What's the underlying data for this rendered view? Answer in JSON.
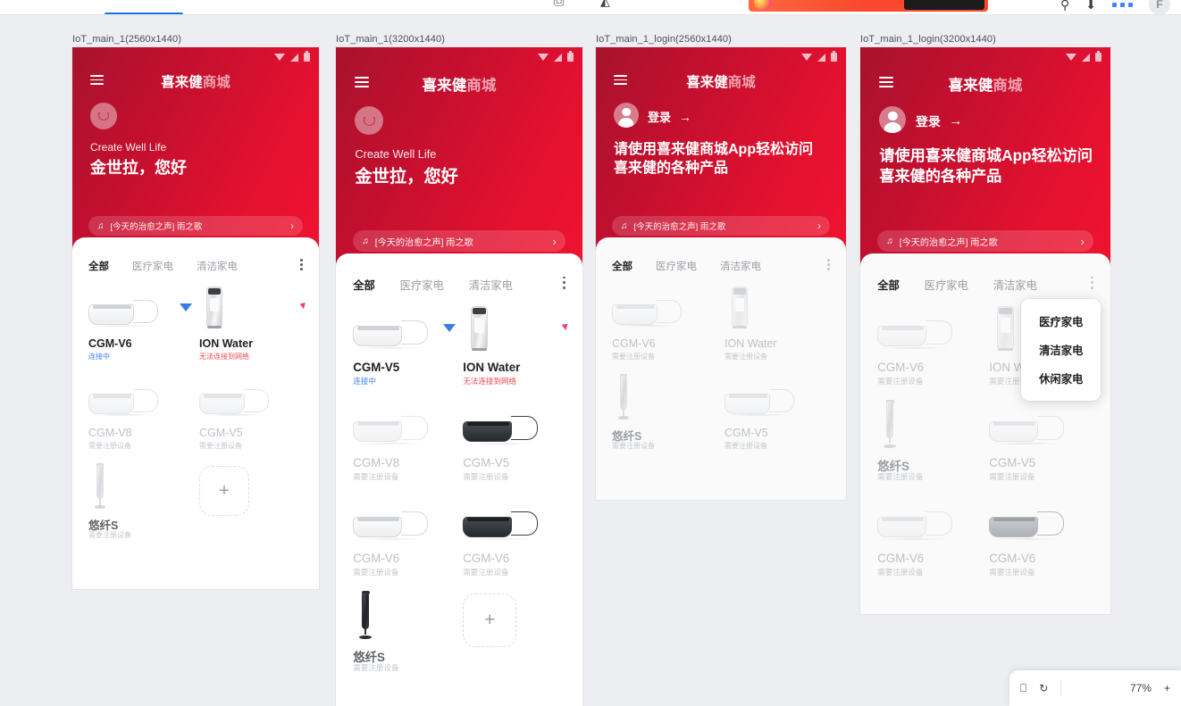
{
  "chrome": {
    "banner_cta_label": "",
    "avatar_initial": "F",
    "search_icon": "search-icon",
    "download_icon": "download-icon",
    "extensions_icon": "extensions-icon",
    "page_icon": "page-icon",
    "shield_icon": "shield-icon"
  },
  "zoom_toolbar": {
    "frame_icon": "frame-icon",
    "refresh_icon": "refresh-icon",
    "percent": "77%",
    "plus_label": "+"
  },
  "common": {
    "brand_strong": "喜来健",
    "brand_weak": "商城",
    "menu_icon": "hamburger-menu-icon",
    "music_note_icon": "music-note-icon",
    "music_text": "[今天的治愈之声] 雨之歌",
    "music_chevron": "›",
    "kebab_icon": "kebab-menu-icon",
    "add_tile_label": "+",
    "tabs": [
      "全部",
      "医疗家电",
      "清洁家电"
    ],
    "status_connecting": "连接中",
    "status_error": "无法连接到网络",
    "status_register": "需要注册设备",
    "login_label": "登录",
    "login_arrow": "→",
    "login_headline": "请使用喜来健商城App轻松访问\n喜来健的各种产品",
    "greet_small": "Create Well Life",
    "greet_big": "金世拉，您好",
    "wifi_badge_icon": "wifi-connecting-icon",
    "wifi_error_badge_icon": "wifi-error-icon"
  },
  "colors": {
    "brand_red": "#e3112f",
    "header_dark_red": "#a8132c",
    "connecting_blue": "#4285f4",
    "error_red": "#ea4c5a",
    "muted_grey": "#bdc1c6",
    "canvas_bg": "#eceef1"
  },
  "artboards": [
    {
      "label": "IoT_main_1(2560x1440)",
      "variant": "logged_in",
      "dim": false,
      "devices": [
        {
          "name": "CGM-V6",
          "status": "连接中",
          "status_type": "connecting",
          "art": "treadmill",
          "tone": "light",
          "badge": "blue"
        },
        {
          "name": "ION Water",
          "status": "无法连接到网络",
          "status_type": "error",
          "art": "purifier",
          "tone": "light",
          "badge": "red"
        },
        {
          "name": "CGM-V8",
          "status": "需要注册设备",
          "status_type": "register",
          "art": "treadmill",
          "tone": "grey",
          "badge": ""
        },
        {
          "name": "CGM-V5",
          "status": "需要注册设备",
          "status_type": "register",
          "art": "treadmill",
          "tone": "grey",
          "badge": ""
        },
        {
          "name": "悠纤S",
          "status": "需要注册设备",
          "status_type": "register",
          "art": "fan",
          "tone": "grey",
          "badge": ""
        }
      ],
      "has_add_tile": true,
      "menu_open": false
    },
    {
      "label": "IoT_main_1(3200x1440)",
      "variant": "logged_in",
      "dim": false,
      "devices": [
        {
          "name": "CGM-V5",
          "status": "连接中",
          "status_type": "connecting",
          "art": "treadmill",
          "tone": "light",
          "badge": "blue"
        },
        {
          "name": "ION Water",
          "status": "无法连接到网络",
          "status_type": "error",
          "art": "purifier",
          "tone": "light",
          "badge": "red"
        },
        {
          "name": "CGM-V8",
          "status": "需要注册设备",
          "status_type": "register",
          "art": "treadmill",
          "tone": "grey",
          "badge": ""
        },
        {
          "name": "CGM-V5",
          "status": "需要注册设备",
          "status_type": "register",
          "art": "treadmill",
          "tone": "dark",
          "badge": ""
        },
        {
          "name": "CGM-V6",
          "status": "需要注册设备",
          "status_type": "register",
          "art": "treadmill",
          "tone": "light",
          "badge": ""
        },
        {
          "name": "CGM-V6",
          "status": "需要注册设备",
          "status_type": "register",
          "art": "treadmill",
          "tone": "dark",
          "badge": ""
        },
        {
          "name": "悠纤S",
          "status": "需要注册设备",
          "status_type": "register",
          "art": "fan",
          "tone": "dark",
          "badge": ""
        }
      ],
      "has_add_tile": true,
      "menu_open": false
    },
    {
      "label": "IoT_main_1_login(2560x1440)",
      "variant": "logged_out",
      "dim": true,
      "devices": [
        {
          "name": "CGM-V6",
          "status": "需要注册设备",
          "status_type": "register",
          "art": "treadmill",
          "tone": "grey",
          "badge": ""
        },
        {
          "name": "ION Water",
          "status": "需要注册设备",
          "status_type": "register",
          "art": "purifier",
          "tone": "grey",
          "badge": ""
        },
        {
          "name": "悠纤S",
          "status": "需要注册设备",
          "status_type": "register",
          "art": "fan",
          "tone": "grey",
          "badge": ""
        },
        {
          "name": "CGM-V5",
          "status": "需要注册设备",
          "status_type": "register",
          "art": "treadmill",
          "tone": "grey",
          "badge": ""
        }
      ],
      "has_add_tile": false,
      "menu_open": false
    },
    {
      "label": "IoT_main_1_login(3200x1440)",
      "variant": "logged_out",
      "dim": true,
      "devices": [
        {
          "name": "CGM-V6",
          "status": "需要注册设备",
          "status_type": "register",
          "art": "treadmill",
          "tone": "grey",
          "badge": ""
        },
        {
          "name": "ION Water",
          "status": "需要注册设备",
          "status_type": "register",
          "art": "purifier",
          "tone": "grey",
          "badge": ""
        },
        {
          "name": "悠纤S",
          "status": "需要注册设备",
          "status_type": "register",
          "art": "fan",
          "tone": "grey",
          "badge": ""
        },
        {
          "name": "CGM-V5",
          "status": "需要注册设备",
          "status_type": "register",
          "art": "treadmill",
          "tone": "grey",
          "badge": ""
        },
        {
          "name": "CGM-V6",
          "status": "需要注册设备",
          "status_type": "register",
          "art": "treadmill",
          "tone": "grey",
          "badge": ""
        },
        {
          "name": "CGM-V6",
          "status": "需要注册设备",
          "status_type": "register",
          "art": "treadmill",
          "tone": "mid",
          "badge": ""
        }
      ],
      "has_add_tile": false,
      "menu_open": true,
      "menu_items": [
        "医疗家电",
        "清洁家电",
        "休闲家电"
      ]
    }
  ]
}
